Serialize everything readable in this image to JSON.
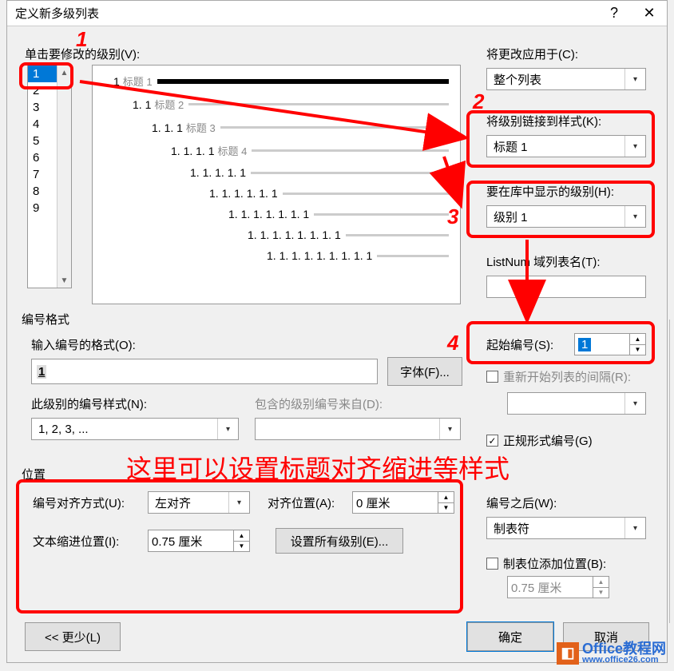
{
  "titlebar": {
    "title": "定义新多级列表"
  },
  "labels": {
    "click_level": "单击要修改的级别(V):",
    "apply_to": "将更改应用于(C):",
    "link_style": "将级别链接到样式(K):",
    "show_level": "要在库中显示的级别(H):",
    "listnum": "ListNum 域列表名(T):",
    "start_label": "起始编号(S):",
    "restart": "重新开始列表的间隔(R):",
    "legal": "正规形式编号(G)",
    "num_format_group": "编号格式",
    "enter_format": "输入编号的格式(O):",
    "font_btn": "字体(F)...",
    "num_style": "此级别的编号样式(N):",
    "include_from": "包含的级别编号来自(D):",
    "position_group": "位置",
    "align_style": "编号对齐方式(U):",
    "align_at": "对齐位置(A):",
    "indent_at": "文本缩进位置(I):",
    "set_all": "设置所有级别(E)...",
    "follow_number": "编号之后(W):",
    "tab_stop_add": "制表位添加位置(B):",
    "less_btn": "<< 更少(L)",
    "ok": "确定",
    "cancel": "取消"
  },
  "levels": [
    "1",
    "2",
    "3",
    "4",
    "5",
    "6",
    "7",
    "8",
    "9"
  ],
  "selected_level": "1",
  "apply_to_value": "整个列表",
  "link_style_value": "标题 1",
  "show_level_value": "级别 1",
  "listnum_value": "",
  "start_value": "1",
  "legal_checked": true,
  "format_value": "1",
  "num_style_value": "1, 2, 3, ...",
  "align_style_value": "左对齐",
  "align_at_value": "0 厘米",
  "indent_at_value": "0.75 厘米",
  "follow_value": "制表符",
  "tab_stop_value": "0.75 厘米",
  "preview": [
    {
      "indent": 12,
      "num": "1",
      "label": "标题 1",
      "bold": true
    },
    {
      "indent": 36,
      "num": "1. 1",
      "label": "标题 2",
      "bold": false
    },
    {
      "indent": 60,
      "num": "1. 1. 1",
      "label": "标题 3",
      "bold": false
    },
    {
      "indent": 84,
      "num": "1. 1. 1. 1",
      "label": "标题 4",
      "bold": false
    },
    {
      "indent": 108,
      "num": "1. 1. 1. 1. 1",
      "label": "",
      "bold": false
    },
    {
      "indent": 132,
      "num": "1. 1. 1. 1. 1. 1",
      "label": "",
      "bold": false
    },
    {
      "indent": 156,
      "num": "1. 1. 1. 1. 1. 1. 1",
      "label": "",
      "bold": false
    },
    {
      "indent": 180,
      "num": "1. 1. 1. 1. 1. 1. 1. 1",
      "label": "",
      "bold": false
    },
    {
      "indent": 204,
      "num": "1. 1. 1. 1. 1. 1. 1. 1. 1",
      "label": "",
      "bold": false
    }
  ],
  "annotations": {
    "n1": "1",
    "n2": "2",
    "n3": "3",
    "n4": "4",
    "hint": "这里可以设置标题对齐缩进等样式"
  },
  "logo_text": "Office教程网",
  "logo_url": "www.office26.com"
}
